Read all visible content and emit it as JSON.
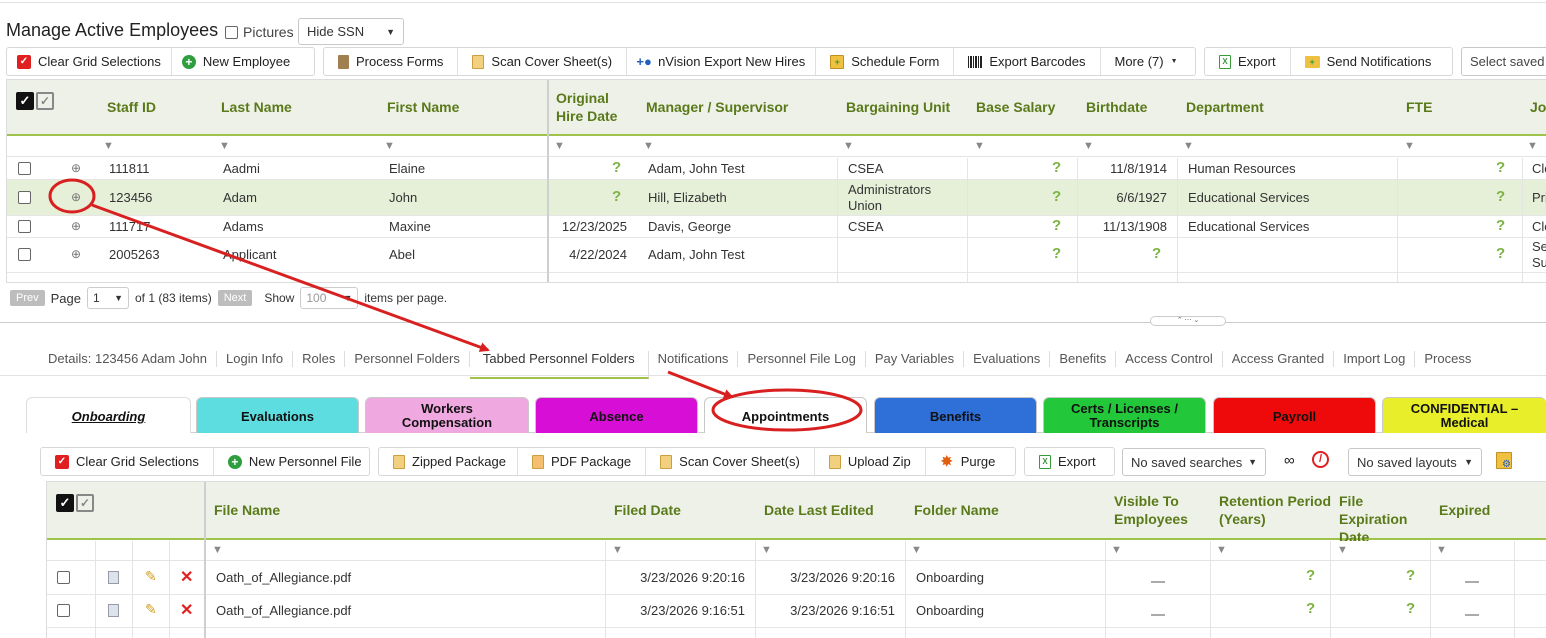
{
  "page_title": "Manage Active Employees",
  "pictures_label": "Pictures",
  "ssn_select": "Hide SSN",
  "toolbar": [
    {
      "label": "Clear Grid Selections",
      "icon": "red-check-icon"
    },
    {
      "label": "New Employee",
      "icon": "green-plus-icon"
    },
    {
      "label": "Process Forms",
      "icon": "document-icon"
    },
    {
      "label": "Scan Cover Sheet(s)",
      "icon": "scan-icon"
    },
    {
      "label": "nVision Export New Hires",
      "icon": "add-user-icon"
    },
    {
      "label": "Schedule Form",
      "icon": "calendar-icon"
    },
    {
      "label": "Export Barcodes",
      "icon": "barcode-icon"
    },
    {
      "label": "More (7)",
      "icon": "dropdown-icon"
    }
  ],
  "toolbar2": [
    {
      "label": "Export",
      "icon": "excel-icon"
    },
    {
      "label": "Send Notifications",
      "icon": "mail-icon"
    }
  ],
  "saved_search_placeholder": "Select saved",
  "employee_grid": {
    "columns": [
      "Staff ID",
      "Last Name",
      "First Name",
      "Original Hire Date",
      "Manager / Supervisor",
      "Bargaining Unit",
      "Base Salary",
      "Birthdate",
      "Department",
      "FTE",
      "Job"
    ],
    "rows": [
      {
        "staff_id": "111811",
        "last": "Aadmi",
        "first": "Elaine",
        "hire": "",
        "manager": "Adam, John Test",
        "unit": "CSEA",
        "salary": "?",
        "birth": "11/8/1914",
        "dept": "Human Resources",
        "fte": "?",
        "job": "Cle"
      },
      {
        "staff_id": "123456",
        "last": "Adam",
        "first": "John",
        "hire": "",
        "manager": "Hill, Elizabeth",
        "unit": "Administrators Union",
        "salary": "?",
        "birth": "6/6/1927",
        "dept": "Educational Services",
        "fte": "?",
        "job": "Pri"
      },
      {
        "staff_id": "111717",
        "last": "Adams",
        "first": "Maxine",
        "hire": "12/23/2025",
        "manager": "Davis, George",
        "unit": "CSEA",
        "salary": "?",
        "birth": "11/13/1908",
        "dept": "Educational Services",
        "fte": "?",
        "job": "Cle"
      },
      {
        "staff_id": "2005263",
        "last": "Applicant",
        "first": "Abel",
        "hire": "4/22/2024",
        "manager": "Adam, John Test",
        "unit": "",
        "salary": "?",
        "birth": "?",
        "dept": "",
        "fte": "?",
        "job": "Se Su"
      }
    ],
    "missing_mark": "?"
  },
  "pager": {
    "prev": "Prev",
    "page_label": "Page",
    "page_value": "1",
    "of_text": "of 1 (83 items)",
    "next": "Next",
    "show_label": "Show",
    "show_value": "100",
    "per_page": "items per page."
  },
  "detail_tabs": [
    "Details: 123456 Adam John",
    "Login Info",
    "Roles",
    "Personnel Folders",
    "Tabbed Personnel Folders",
    "Notifications",
    "Personnel File Log",
    "Pay Variables",
    "Evaluations",
    "Benefits",
    "Access Control",
    "Access Granted",
    "Import Log",
    "Process"
  ],
  "folder_tabs": [
    {
      "label": "Onboarding",
      "color": "#ffffff"
    },
    {
      "label": "Evaluations",
      "color": "#5ddde0"
    },
    {
      "label": "Workers Compensation",
      "color": "#f0a8e0"
    },
    {
      "label": "Absence",
      "color": "#d60ed6"
    },
    {
      "label": "Appointments",
      "color": "#ffffff"
    },
    {
      "label": "Benefits",
      "color": "#2e6fd8"
    },
    {
      "label": "Certs / Licenses / Transcripts",
      "color": "#22c83a"
    },
    {
      "label": "Payroll",
      "color": "#ee0a0a"
    },
    {
      "label": "CONFIDENTIAL – Medical",
      "color": "#e8ee2a"
    }
  ],
  "file_toolbar": [
    {
      "label": "Clear Grid Selections",
      "icon": "red-check-icon"
    },
    {
      "label": "New Personnel File",
      "icon": "green-plus-icon"
    },
    {
      "label": "Zipped Package",
      "icon": "zip-icon"
    },
    {
      "label": "PDF Package",
      "icon": "pdf-icon"
    },
    {
      "label": "Scan Cover Sheet(s)",
      "icon": "scan-icon"
    },
    {
      "label": "Upload Zip",
      "icon": "upload-icon"
    },
    {
      "label": "Purge",
      "icon": "purge-icon"
    },
    {
      "label": "Export",
      "icon": "excel-icon"
    }
  ],
  "saved_searches": "No saved searches",
  "saved_layouts": "No saved layouts",
  "file_grid": {
    "columns": [
      "File Name",
      "Filed Date",
      "Date Last Edited",
      "Folder Name",
      "Visible To Employees",
      "Retention Period (Years)",
      "File Expiration Date",
      "Expired"
    ],
    "rows": [
      {
        "name": "Oath_of_Allegiance.pdf",
        "filed": "3/23/2026 9:20:16",
        "edited": "3/23/2026 9:20:16",
        "folder": "Onboarding",
        "retention": "?",
        "expiration": "?"
      },
      {
        "name": "Oath_of_Allegiance.pdf",
        "filed": "3/23/2026 9:16:51",
        "edited": "3/23/2026 9:16:51",
        "folder": "Onboarding",
        "retention": "?",
        "expiration": "?"
      }
    ]
  },
  "colors": {
    "accent_green": "#9ec24a",
    "header_text": "#5a7a1a",
    "annotation_red": "#d92020",
    "question_green": "#7cb342"
  }
}
